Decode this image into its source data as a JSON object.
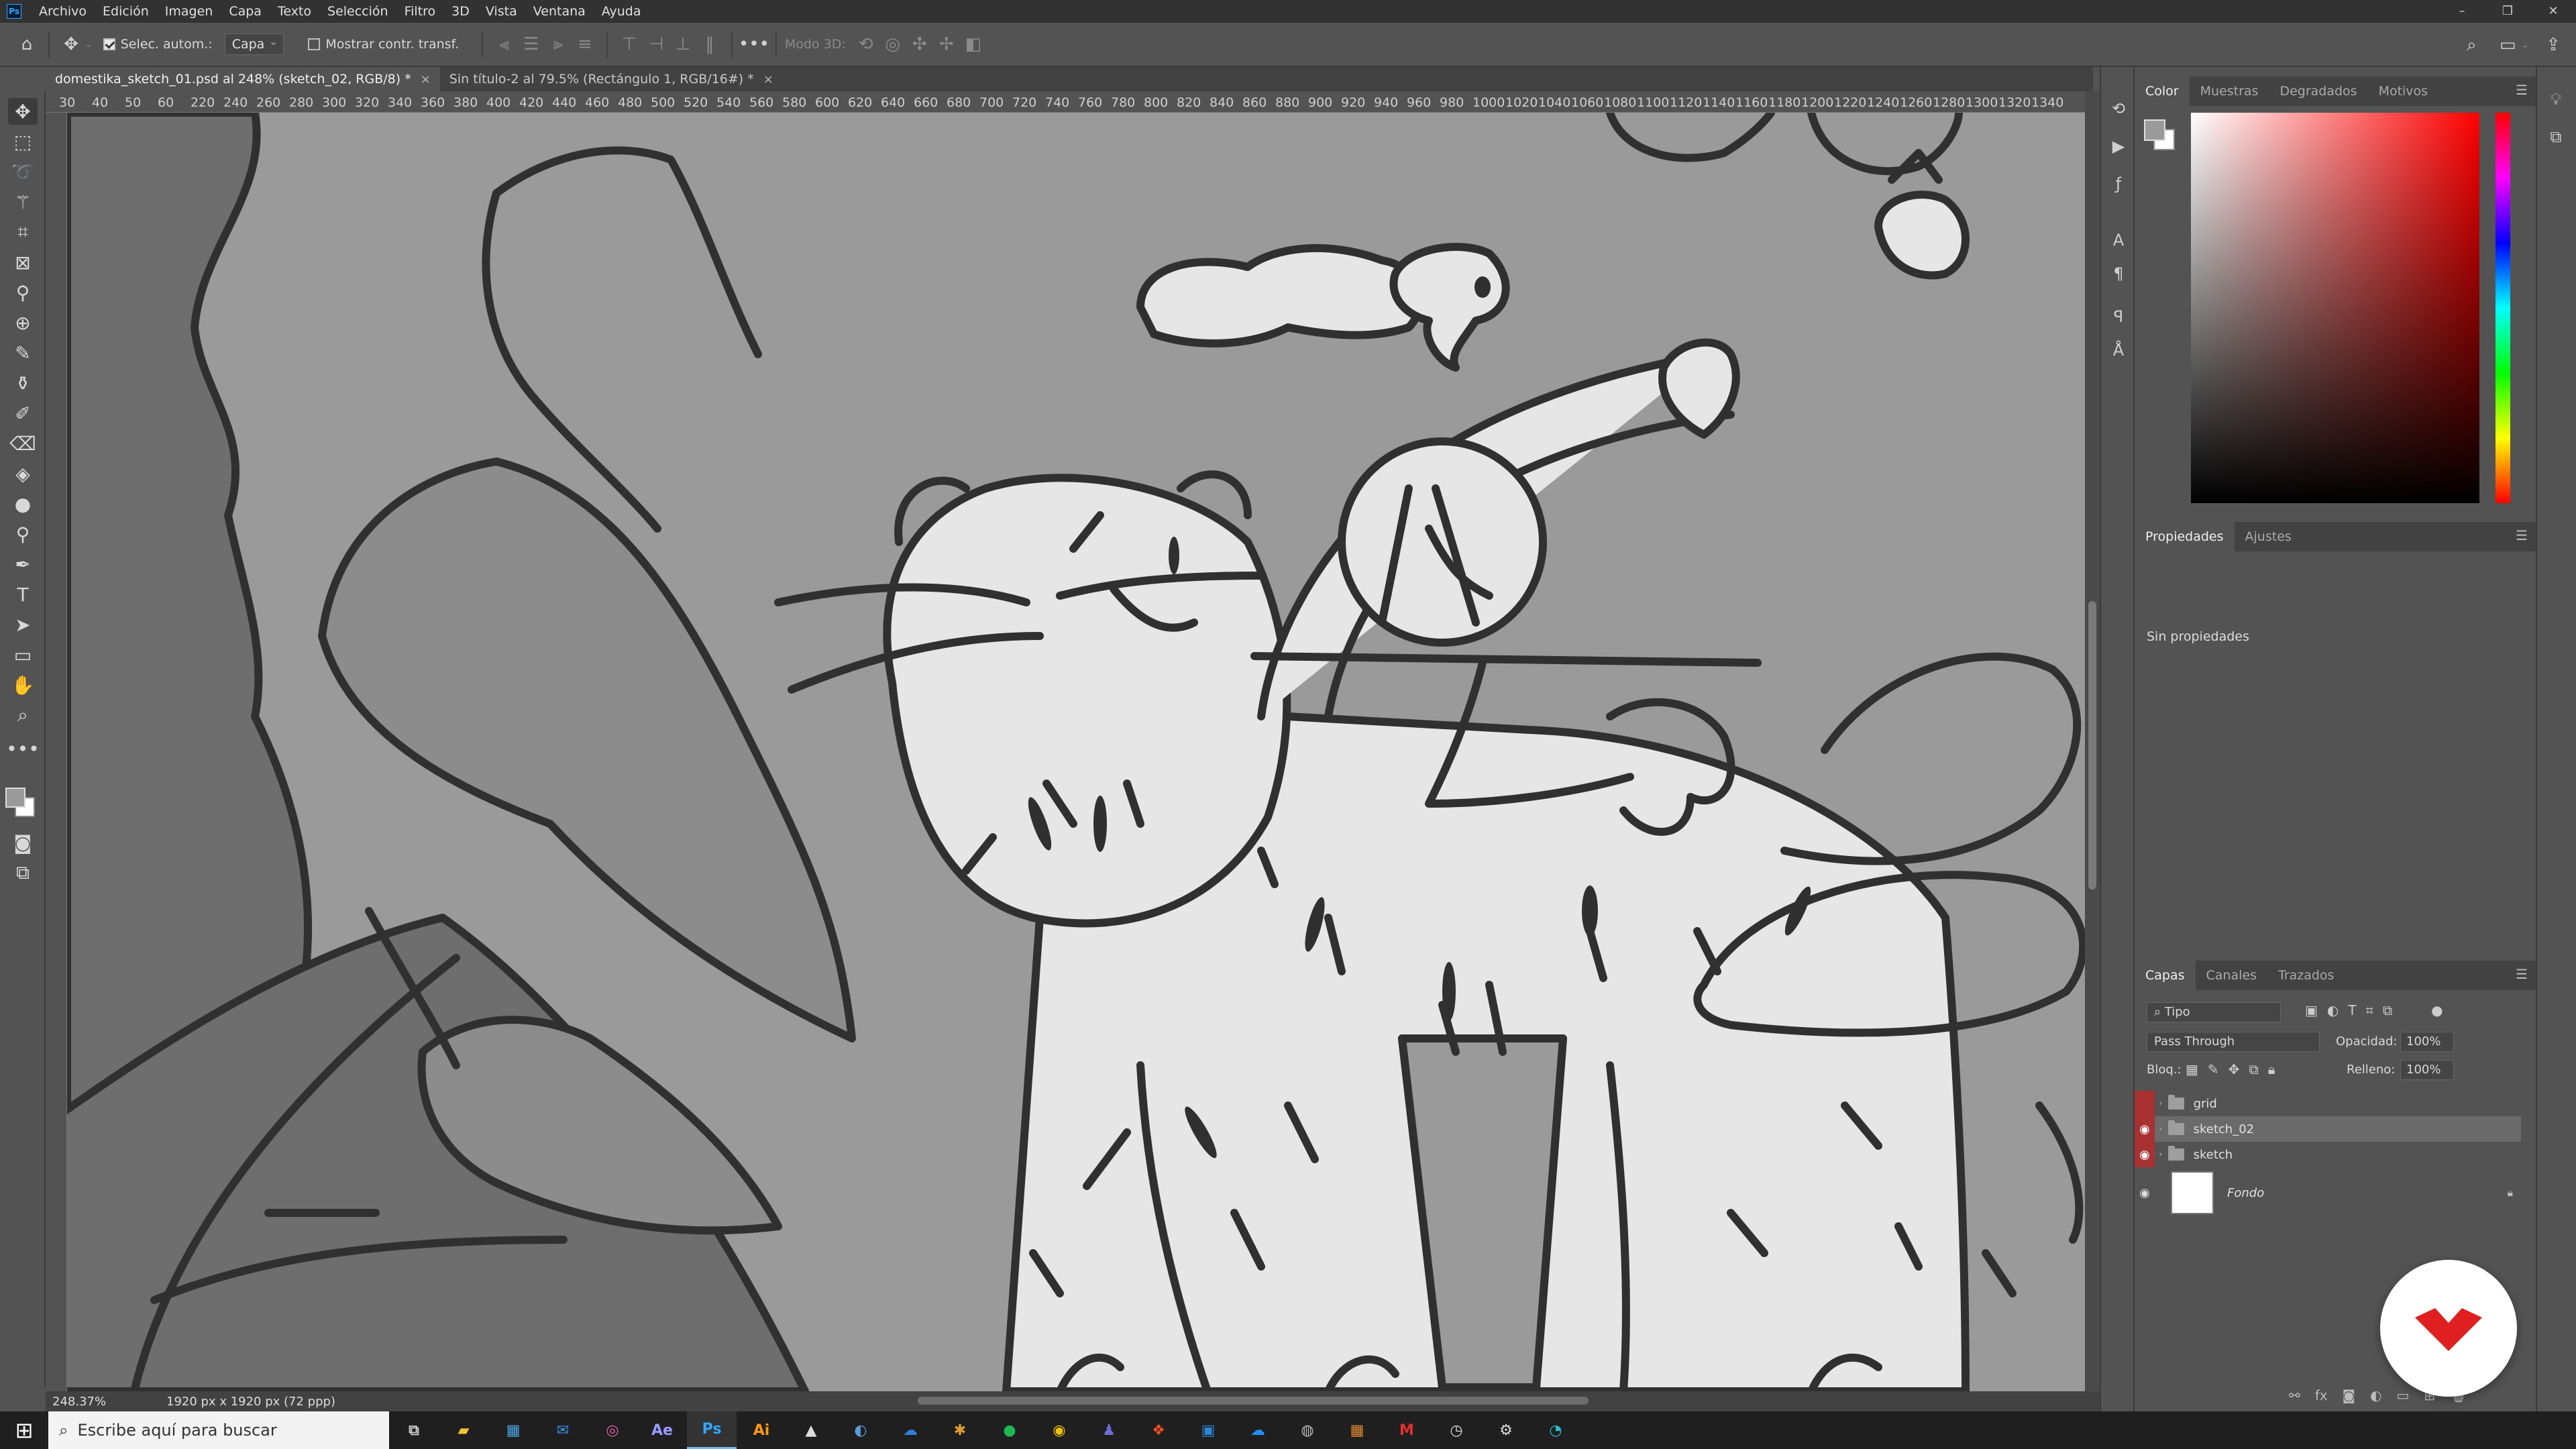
{
  "menubar": {
    "app_logo": "Ps",
    "items": [
      "Archivo",
      "Edición",
      "Imagen",
      "Capa",
      "Texto",
      "Selección",
      "Filtro",
      "3D",
      "Vista",
      "Ventana",
      "Ayuda"
    ],
    "window_controls": [
      "–",
      "❐",
      "✕"
    ]
  },
  "options": {
    "auto_select_label": "Selec. autom.:",
    "auto_select_target": "Capa",
    "show_transform_label": "Mostrar contr. transf.",
    "mode_3d_label": "Modo 3D:"
  },
  "tabs": [
    {
      "label": "domestika_sketch_01.psd al 248% (sketch_02, RGB/8) *",
      "close": "×"
    },
    {
      "label": "Sin título-2 al 79.5% (Rectángulo 1, RGB/16#) *",
      "close": "×"
    }
  ],
  "ruler": {
    "top_labels": [
      "30",
      "40",
      "50",
      "60",
      "220",
      "240",
      "260",
      "280",
      "300",
      "320",
      "340",
      "360",
      "380",
      "400",
      "420",
      "440",
      "460",
      "480",
      "500",
      "520",
      "540",
      "560",
      "580",
      "600",
      "620",
      "640",
      "660",
      "680",
      "700",
      "720",
      "740",
      "760",
      "780",
      "800",
      "820",
      "840",
      "860",
      "880",
      "900",
      "920",
      "940",
      "960",
      "980",
      "1000",
      "1020",
      "1040",
      "1060",
      "1080",
      "1100",
      "1120",
      "1140",
      "1160",
      "1180",
      "1200",
      "1220",
      "1240",
      "1260",
      "1280",
      "1300",
      "1320",
      "1340"
    ]
  },
  "status": {
    "zoom": "248.37%",
    "doc_size": "1920 px x 1920 px (72 ppp)"
  },
  "color_panel": {
    "tabs": [
      "Color",
      "Muestras",
      "Degradados",
      "Motivos"
    ],
    "active_tab": "Color"
  },
  "properties_panel": {
    "tabs": [
      "Propiedades",
      "Ajustes"
    ],
    "active_tab": "Propiedades",
    "empty_text": "Sin propiedades"
  },
  "layers_panel": {
    "tabs": [
      "Capas",
      "Canales",
      "Trazados"
    ],
    "active_tab": "Capas",
    "filter_label": "Tipo",
    "blend_mode": "Pass Through",
    "opacity_label": "Opacidad:",
    "opacity_value": "100%",
    "lock_label": "Bloq.:",
    "fill_label": "Relleno:",
    "fill_value": "100%",
    "layers": [
      {
        "name": "grid",
        "type": "group",
        "visible": false,
        "selected": false
      },
      {
        "name": "sketch_02",
        "type": "group",
        "visible": true,
        "selected": true
      },
      {
        "name": "sketch",
        "type": "group",
        "visible": true,
        "selected": false
      },
      {
        "name": "Fondo",
        "type": "background",
        "visible": true,
        "selected": false
      }
    ]
  },
  "taskbar": {
    "search_placeholder": "Escribe aquí para buscar",
    "apps": [
      "Ae",
      "Ps",
      "Ai"
    ]
  },
  "colors": {
    "accent_red": "#a83232",
    "canvas_bg": "#9a9a9a",
    "brand_red": "#e02020"
  }
}
